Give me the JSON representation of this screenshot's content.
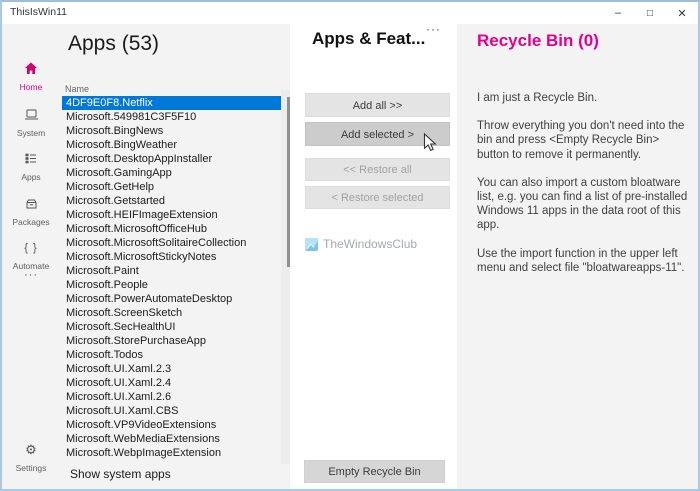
{
  "colors": {
    "accent": "#e3008c",
    "selection": "#0078d7"
  },
  "window": {
    "title": "ThisIsWin11",
    "controls": {
      "minimize": "–",
      "maximize": "□",
      "close": "✕"
    }
  },
  "sidebar": {
    "items": [
      {
        "label": "Home",
        "icon": "home-icon",
        "active": true
      },
      {
        "label": "System",
        "icon": "laptop-icon",
        "active": false
      },
      {
        "label": "Apps",
        "icon": "list-icon",
        "active": false
      },
      {
        "label": "Packages",
        "icon": "package-box-icon",
        "active": false
      },
      {
        "label": "Automate",
        "icon": "braces-icon",
        "glyph": "{ }",
        "active": false
      },
      {
        "label": "",
        "icon": "more-icon",
        "glyph": "···",
        "active": false
      }
    ],
    "settings": {
      "label": "Settings",
      "icon": "gear-icon",
      "glyph": "⚙"
    }
  },
  "apps": {
    "title": "Apps (53)",
    "column_header": "Name",
    "selected_index": 0,
    "items": [
      "4DF9E0F8.Netflix",
      "Microsoft.549981C3F5F10",
      "Microsoft.BingNews",
      "Microsoft.BingWeather",
      "Microsoft.DesktopAppInstaller",
      "Microsoft.GamingApp",
      "Microsoft.GetHelp",
      "Microsoft.Getstarted",
      "Microsoft.HEIFImageExtension",
      "Microsoft.MicrosoftOfficeHub",
      "Microsoft.MicrosoftSolitaireCollection",
      "Microsoft.MicrosoftStickyNotes",
      "Microsoft.Paint",
      "Microsoft.People",
      "Microsoft.PowerAutomateDesktop",
      "Microsoft.ScreenSketch",
      "Microsoft.SecHealthUI",
      "Microsoft.StorePurchaseApp",
      "Microsoft.Todos",
      "Microsoft.UI.Xaml.2.3",
      "Microsoft.UI.Xaml.2.4",
      "Microsoft.UI.Xaml.2.6",
      "Microsoft.UI.Xaml.CBS",
      "Microsoft.VP9VideoExtensions",
      "Microsoft.WebMediaExtensions",
      "Microsoft.WebpImageExtension"
    ],
    "footer_link": "Show system apps"
  },
  "transfer": {
    "title": "Apps & Feat...",
    "menu": "···",
    "buttons": {
      "add_all": "Add all >>",
      "add_selected": "Add selected >",
      "restore_all": "<< Restore all",
      "restore_selected": "< Restore selected",
      "empty_bin": "Empty Recycle Bin"
    },
    "watermark": "TheWindowsClub"
  },
  "recycle": {
    "title": "Recycle Bin (0)",
    "paragraphs": [
      "I am just a Recycle Bin.",
      "Throw everything you don't need into the bin and press <Empty Recycle Bin> button to remove it permanently.",
      "You can also import a custom bloatware list, e.g. you can find a list of pre-installed Windows 11 apps in the data root of this app.",
      "Use the import function in the upper left menu and select file \"bloatwareapps-11\"."
    ]
  }
}
